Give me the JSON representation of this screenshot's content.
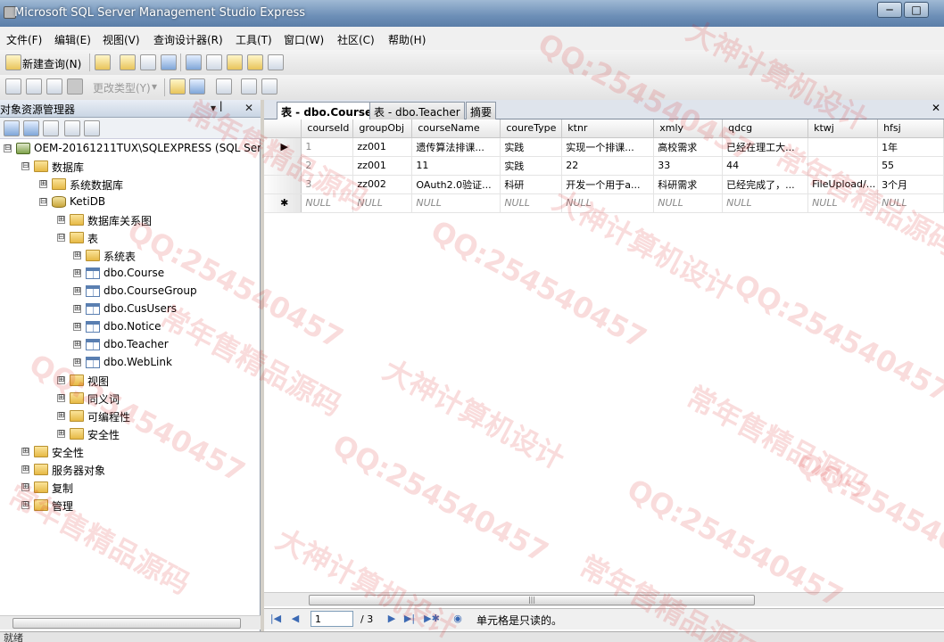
{
  "window": {
    "title": "Microsoft SQL Server Management Studio Express",
    "minimize_label": "─",
    "maximize_label": "□"
  },
  "menu": [
    "文件(F)",
    "编辑(E)",
    "视图(V)",
    "查询设计器(R)",
    "工具(T)",
    "窗口(W)",
    "社区(C)",
    "帮助(H)"
  ],
  "toolbar": {
    "new_query": "新建查询(N)",
    "change_type": "更改类型(Y)",
    "change_type_caret": "▾"
  },
  "object_explorer": {
    "title": "对象资源管理器",
    "pin": "▾ ꟾ",
    "close": "✕",
    "tree": [
      {
        "label": "OEM-20161211TUX\\SQLEXPRESS (SQL Serv",
        "expander": "⊟",
        "icon": "server"
      },
      {
        "label": "数据库",
        "expander": "⊟",
        "icon": "folder"
      },
      {
        "label": "系统数据库",
        "expander": "⊞",
        "icon": "folder"
      },
      {
        "label": "KetiDB",
        "expander": "⊟",
        "icon": "db"
      },
      {
        "label": "数据库关系图",
        "expander": "⊞",
        "icon": "folder"
      },
      {
        "label": "表",
        "expander": "⊟",
        "icon": "folder"
      },
      {
        "label": "系统表",
        "expander": "⊞",
        "icon": "folder"
      },
      {
        "label": "dbo.Course",
        "expander": "⊞",
        "icon": "table"
      },
      {
        "label": "dbo.CourseGroup",
        "expander": "⊞",
        "icon": "table"
      },
      {
        "label": "dbo.CusUsers",
        "expander": "⊞",
        "icon": "table"
      },
      {
        "label": "dbo.Notice",
        "expander": "⊞",
        "icon": "table"
      },
      {
        "label": "dbo.Teacher",
        "expander": "⊞",
        "icon": "table"
      },
      {
        "label": "dbo.WebLink",
        "expander": "⊞",
        "icon": "table"
      },
      {
        "label": "视图",
        "expander": "⊞",
        "icon": "folder"
      },
      {
        "label": "同义词",
        "expander": "⊞",
        "icon": "folder"
      },
      {
        "label": "可编程性",
        "expander": "⊞",
        "icon": "folder"
      },
      {
        "label": "安全性",
        "expander": "⊞",
        "icon": "folder"
      },
      {
        "label": "安全性",
        "expander": "⊞",
        "icon": "folder"
      },
      {
        "label": "服务器对象",
        "expander": "⊞",
        "icon": "folder"
      },
      {
        "label": "复制",
        "expander": "⊞",
        "icon": "folder"
      },
      {
        "label": "管理",
        "expander": "⊞",
        "icon": "folder"
      }
    ]
  },
  "tabs": [
    {
      "label": "表 - dbo.Course",
      "active": true
    },
    {
      "label": "表 - dbo.Teacher",
      "active": false
    },
    {
      "label": "摘要",
      "active": false
    }
  ],
  "tab_close": "✕",
  "grid": {
    "columns": [
      "courseId",
      "groupObj",
      "courseName",
      "coureType",
      "ktnr",
      "xmly",
      "qdcg",
      "ktwj",
      "hfsj"
    ],
    "rows": [
      {
        "marker": "▶",
        "cells": [
          "1",
          "zz001",
          "遗传算法排课...",
          "实践",
          "实现一个排课...",
          "高校需求",
          "已经在理工大...",
          "",
          "1年"
        ]
      },
      {
        "marker": "",
        "cells": [
          "2",
          "zz001",
          "11",
          "实践",
          "22",
          "33",
          "44",
          "",
          "55"
        ]
      },
      {
        "marker": "",
        "cells": [
          "3",
          "zz002",
          "OAuth2.0验证...",
          "科研",
          "开发一个用于a...",
          "科研需求",
          "已经完成了，...",
          "FileUpload/...",
          "3个月"
        ]
      },
      {
        "marker": "✱",
        "cells": [
          "NULL",
          "NULL",
          "NULL",
          "NULL",
          "NULL",
          "NULL",
          "NULL",
          "NULL",
          "NULL"
        ]
      }
    ]
  },
  "nav": {
    "current": "1",
    "total": "/ 3",
    "status": "单元格是只读的。",
    "first": "|◀",
    "prev": "◀",
    "next": "▶",
    "last": "▶|",
    "new": "▶✱",
    "stop": "◉"
  },
  "statusbar": "就绪",
  "watermarks": [
    "QQ:254540457",
    "大神计算机设计",
    "常年售精品源码"
  ]
}
